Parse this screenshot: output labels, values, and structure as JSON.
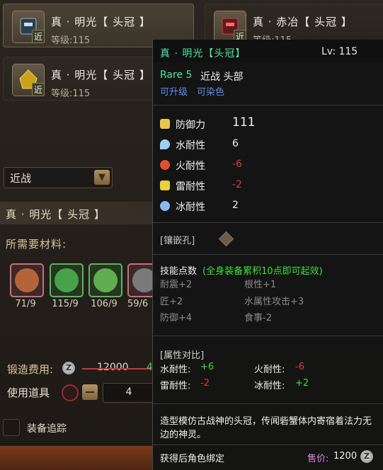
{
  "equipment_list": [
    {
      "name": "真 · 明光【 头冠 】",
      "level": "等级:115",
      "badge": "近"
    },
    {
      "name": "真 · 赤冶【 头冠 】",
      "level": "等级:115",
      "badge": "近"
    },
    {
      "name": "真 · 明光【 头冠 】",
      "level": "等级:115",
      "badge": "近"
    }
  ],
  "filter": {
    "selected": "近战"
  },
  "craft": {
    "title": "真 · 明光【 头冠 】",
    "materials_label": "所需要材料:",
    "materials": [
      {
        "count": "71/9",
        "color": "#b5643a"
      },
      {
        "count": "115/9",
        "color": "#47a24a"
      },
      {
        "count": "106/9",
        "color": "#5fae4f"
      },
      {
        "count": "59/6",
        "color": "#7a7a7a"
      }
    ],
    "fee_label": "锻造费用:",
    "fee_original": "12000",
    "fee_discount": "4",
    "tool_label": "使用道具",
    "tool_qty": "4",
    "track_label": "装备追踪"
  },
  "tooltip": {
    "name": "真 · 明光【头冠】",
    "level": "Lv: 115",
    "rare": "Rare 5",
    "type": "近战  头部",
    "upgradable": "可升级",
    "dyeable": "可染色",
    "stats": [
      {
        "label": "防御力",
        "value": "111",
        "icon": "shield-icon",
        "color": "#e8c84a"
      },
      {
        "label": "水耐性",
        "value": "6",
        "icon": "water-icon",
        "color": "#9ad0f0"
      },
      {
        "label": "火耐性",
        "value": "-6",
        "icon": "fire-icon",
        "color": "#e0502a"
      },
      {
        "label": "雷耐性",
        "value": "-2",
        "icon": "thunder-icon",
        "color": "#e8d040"
      },
      {
        "label": "冰耐性",
        "value": "2",
        "icon": "ice-icon",
        "color": "#8ab8f0"
      }
    ],
    "slots_label": "[镶嵌孔]",
    "skills_label": "技能点数",
    "skills_note": "(全身装备累积10点即可起效)",
    "skills": [
      {
        "text": "耐震+2"
      },
      {
        "text": "根性+1"
      },
      {
        "text": "匠+2"
      },
      {
        "text": "水属性攻击+3"
      },
      {
        "text": "防御+4"
      },
      {
        "text": "食事-2"
      }
    ],
    "compare_label": "[属性对比]",
    "compare": [
      {
        "label": "水耐性:",
        "value": "+6",
        "sign": "pos"
      },
      {
        "label": "火耐性:",
        "value": "-6",
        "sign": "neg"
      },
      {
        "label": "雷耐性:",
        "value": "-2",
        "sign": "neg"
      },
      {
        "label": "冰耐性:",
        "value": "+2",
        "sign": "pos"
      }
    ],
    "description": "造型模仿古战神的头冠，传闻砦蟹体内寄宿着法力无边的神灵。",
    "binding": "获得后角色绑定",
    "price_label": "售价:",
    "price_value": "1200"
  }
}
